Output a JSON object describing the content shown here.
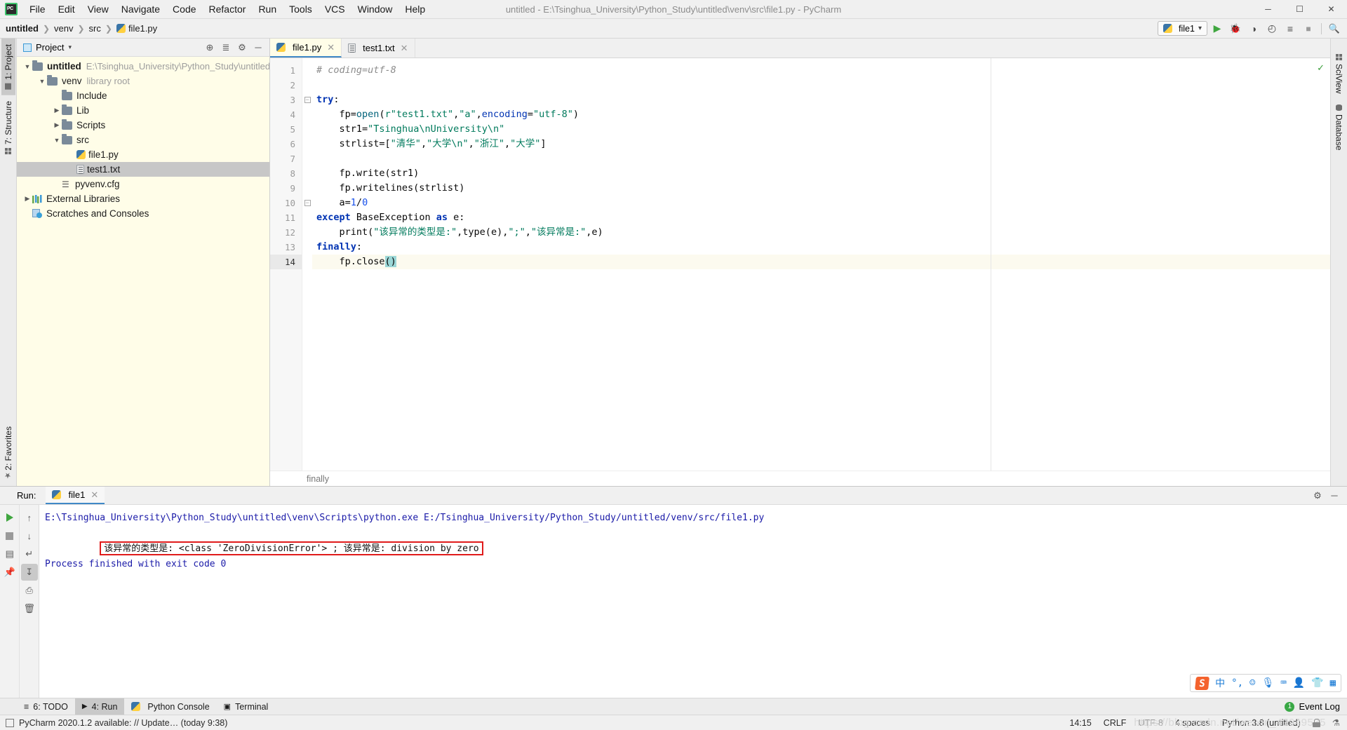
{
  "window": {
    "title": "untitled - E:\\Tsinghua_University\\Python_Study\\untitled\\venv\\src\\file1.py - PyCharm",
    "minimize": "─",
    "maximize": "☐",
    "close": "✕"
  },
  "menu": [
    "File",
    "Edit",
    "View",
    "Navigate",
    "Code",
    "Refactor",
    "Run",
    "Tools",
    "VCS",
    "Window",
    "Help"
  ],
  "breadcrumb": {
    "project": "untitled",
    "venv": "venv",
    "src": "src",
    "file": "file1.py",
    "separator": "❯"
  },
  "toolbar": {
    "run_config": "file1",
    "dropdown_caret": "▾",
    "buttons": [
      {
        "name": "run-button",
        "glyph": "▶",
        "color": "#3fa63f"
      },
      {
        "name": "debug-button",
        "glyph": "🐞",
        "color": "#3fa63f"
      },
      {
        "name": "run-coverage-button",
        "glyph": "◑",
        "color": "#4a4a4a"
      },
      {
        "name": "profile-button",
        "glyph": "◴",
        "color": "#4a4a4a"
      },
      {
        "name": "run-with-params-button",
        "glyph": "≡",
        "color": "#4a4a4a"
      },
      {
        "name": "stop-button",
        "glyph": "■",
        "color": "#9a9a9a"
      },
      {
        "name": "search-everywhere-button",
        "glyph": "🔍",
        "color": "#4a4a4a"
      }
    ]
  },
  "left_strip": [
    {
      "label": "1: Project",
      "active": true,
      "icon": "project-icon"
    },
    {
      "label": "7: Structure",
      "active": false,
      "icon": "structure-icon"
    },
    {
      "label": "2: Favorites",
      "active": false,
      "icon": "star-icon"
    }
  ],
  "right_strip": [
    {
      "label": "SciView",
      "icon": "sciview-icon"
    },
    {
      "label": "Database",
      "icon": "database-icon"
    }
  ],
  "project_panel": {
    "title": "Project",
    "caret": "▾",
    "actions": [
      {
        "name": "locate-icon",
        "glyph": "⊕"
      },
      {
        "name": "collapse-all-icon",
        "glyph": "≣"
      },
      {
        "name": "settings-gear-icon",
        "glyph": "⚙"
      },
      {
        "name": "hide-panel-icon",
        "glyph": "─"
      }
    ],
    "tree": [
      {
        "depth": 0,
        "arrow": "▼",
        "icon": "folder",
        "label": "untitled",
        "bold": true,
        "hint": "E:\\Tsinghua_University\\Python_Study\\untitled",
        "selected": false
      },
      {
        "depth": 1,
        "arrow": "▼",
        "icon": "folder",
        "label": "venv",
        "bold": false,
        "hint": "library root",
        "selected": false
      },
      {
        "depth": 2,
        "arrow": "",
        "icon": "folder",
        "label": "Include",
        "bold": false,
        "hint": "",
        "selected": false
      },
      {
        "depth": 2,
        "arrow": "▶",
        "icon": "folder",
        "label": "Lib",
        "bold": false,
        "hint": "",
        "selected": false
      },
      {
        "depth": 2,
        "arrow": "▶",
        "icon": "folder",
        "label": "Scripts",
        "bold": false,
        "hint": "",
        "selected": false
      },
      {
        "depth": 2,
        "arrow": "▼",
        "icon": "folder",
        "label": "src",
        "bold": false,
        "hint": "",
        "selected": false
      },
      {
        "depth": 3,
        "arrow": "",
        "icon": "python",
        "label": "file1.py",
        "bold": false,
        "hint": "",
        "selected": false
      },
      {
        "depth": 3,
        "arrow": "",
        "icon": "text",
        "label": "test1.txt",
        "bold": false,
        "hint": "",
        "selected": true
      },
      {
        "depth": 2,
        "arrow": "",
        "icon": "cfg",
        "label": "pyvenv.cfg",
        "bold": false,
        "hint": "",
        "selected": false
      },
      {
        "depth": 0,
        "arrow": "▶",
        "icon": "lib",
        "label": "External Libraries",
        "bold": false,
        "hint": "",
        "selected": false
      },
      {
        "depth": 0,
        "arrow": "",
        "icon": "scratch",
        "label": "Scratches and Consoles",
        "bold": false,
        "hint": "",
        "selected": false
      }
    ]
  },
  "editor": {
    "tabs": [
      {
        "label": "file1.py",
        "icon": "python",
        "active": true,
        "close": "✕"
      },
      {
        "label": "test1.txt",
        "icon": "text",
        "active": false,
        "close": "✕"
      }
    ],
    "line_numbers": [
      "1",
      "2",
      "3",
      "4",
      "5",
      "6",
      "7",
      "8",
      "9",
      "10",
      "11",
      "12",
      "13",
      "14"
    ],
    "lines": [
      {
        "n": 1,
        "current": false,
        "fold": "",
        "tokens": [
          {
            "t": "# coding=utf-8",
            "c": "cmt"
          }
        ]
      },
      {
        "n": 2,
        "current": false,
        "fold": "",
        "tokens": []
      },
      {
        "n": 3,
        "current": false,
        "fold": "minus",
        "tokens": [
          {
            "t": "try",
            "c": "kw"
          },
          {
            "t": ":",
            "c": "plain"
          }
        ]
      },
      {
        "n": 4,
        "current": false,
        "fold": "",
        "tokens": [
          {
            "t": "    fp",
            "c": "plain"
          },
          {
            "t": "=",
            "c": "plain"
          },
          {
            "t": "open",
            "c": "fn"
          },
          {
            "t": "(",
            "c": "plain"
          },
          {
            "t": "r\"test1.txt\"",
            "c": "str"
          },
          {
            "t": ",",
            "c": "plain"
          },
          {
            "t": "\"a\"",
            "c": "str"
          },
          {
            "t": ",",
            "c": "plain"
          },
          {
            "t": "encoding",
            "c": "kw2"
          },
          {
            "t": "=",
            "c": "plain"
          },
          {
            "t": "\"utf-8\"",
            "c": "str"
          },
          {
            "t": ")",
            "c": "plain"
          }
        ]
      },
      {
        "n": 5,
        "current": false,
        "fold": "",
        "tokens": [
          {
            "t": "    str1",
            "c": "plain"
          },
          {
            "t": "=",
            "c": "plain"
          },
          {
            "t": "\"Tsinghua\\nUniversity\\n\"",
            "c": "str"
          }
        ]
      },
      {
        "n": 6,
        "current": false,
        "fold": "",
        "tokens": [
          {
            "t": "    strlist",
            "c": "plain"
          },
          {
            "t": "=[",
            "c": "plain"
          },
          {
            "t": "\"清华\"",
            "c": "str"
          },
          {
            "t": ",",
            "c": "plain"
          },
          {
            "t": "\"大学\\n\"",
            "c": "str"
          },
          {
            "t": ",",
            "c": "plain"
          },
          {
            "t": "\"浙江\"",
            "c": "str"
          },
          {
            "t": ",",
            "c": "plain"
          },
          {
            "t": "\"大学\"",
            "c": "str"
          },
          {
            "t": "]",
            "c": "plain"
          }
        ]
      },
      {
        "n": 7,
        "current": false,
        "fold": "",
        "tokens": []
      },
      {
        "n": 8,
        "current": false,
        "fold": "",
        "tokens": [
          {
            "t": "    fp.write(str1)",
            "c": "plain"
          }
        ]
      },
      {
        "n": 9,
        "current": false,
        "fold": "",
        "tokens": [
          {
            "t": "    fp.writelines(strlist)",
            "c": "plain"
          }
        ]
      },
      {
        "n": 10,
        "current": false,
        "fold": "minus",
        "tokens": [
          {
            "t": "    a",
            "c": "plain"
          },
          {
            "t": "=",
            "c": "plain"
          },
          {
            "t": "1",
            "c": "num"
          },
          {
            "t": "/",
            "c": "plain"
          },
          {
            "t": "0",
            "c": "num"
          }
        ]
      },
      {
        "n": 11,
        "current": false,
        "fold": "",
        "tokens": [
          {
            "t": "except",
            "c": "kw"
          },
          {
            "t": " BaseException ",
            "c": "plain"
          },
          {
            "t": "as",
            "c": "kw"
          },
          {
            "t": " e:",
            "c": "plain"
          }
        ]
      },
      {
        "n": 12,
        "current": false,
        "fold": "",
        "tokens": [
          {
            "t": "    print(",
            "c": "plain"
          },
          {
            "t": "\"该异常的类型是:\"",
            "c": "str"
          },
          {
            "t": ",type(e),",
            "c": "plain"
          },
          {
            "t": "\";\"",
            "c": "str"
          },
          {
            "t": ",",
            "c": "plain"
          },
          {
            "t": "\"该异常是:\"",
            "c": "str"
          },
          {
            "t": ",e)",
            "c": "plain"
          }
        ]
      },
      {
        "n": 13,
        "current": false,
        "fold": "",
        "tokens": [
          {
            "t": "finally",
            "c": "kw"
          },
          {
            "t": ":",
            "c": "plain"
          }
        ]
      },
      {
        "n": 14,
        "current": true,
        "fold": "",
        "tokens": [
          {
            "t": "    fp.close",
            "c": "plain"
          },
          {
            "t": "()",
            "c": "plain",
            "hl": true
          }
        ]
      }
    ],
    "status_breadcrumb": "finally",
    "inspection_ok": "✓"
  },
  "run_panel": {
    "label": "Run:",
    "tab": "file1",
    "tab_close": "✕",
    "actions": [
      {
        "name": "settings-gear-icon",
        "glyph": "⚙"
      },
      {
        "name": "hide-panel-icon",
        "glyph": "─"
      }
    ],
    "side_buttons_left": [
      {
        "name": "rerun-button",
        "glyph": "play"
      },
      {
        "name": "stop-button",
        "glyph": "stop"
      },
      {
        "name": "layout-button",
        "glyph": "▤"
      },
      {
        "name": "pin-tab-button",
        "glyph": "📌"
      }
    ],
    "side_buttons_right": [
      {
        "name": "scroll-up-button",
        "glyph": "↑"
      },
      {
        "name": "scroll-down-button",
        "glyph": "↓"
      },
      {
        "name": "soft-wrap-button",
        "glyph": "↵"
      },
      {
        "name": "scroll-to-end-button",
        "glyph": "↧",
        "active": true
      },
      {
        "name": "print-button",
        "glyph": "⎙"
      },
      {
        "name": "clear-all-button",
        "glyph": "🗑"
      }
    ],
    "console": {
      "command": "E:\\Tsinghua_University\\Python_Study\\untitled\\venv\\Scripts\\python.exe E:/Tsinghua_University/Python_Study/untitled/venv/src/file1.py",
      "highlighted_output": "该异常的类型是: <class 'ZeroDivisionError'> ; 该异常是: division by zero",
      "exit_message": "Process finished with exit code 0",
      "highlight_color": "#e01b1b"
    },
    "ime": {
      "logo": "S",
      "items": [
        {
          "name": "chinese-mode-icon",
          "glyph": "中"
        },
        {
          "name": "punctuation-icon",
          "glyph": "°,"
        },
        {
          "name": "emoji-icon",
          "glyph": "☺"
        },
        {
          "name": "voice-input-icon",
          "glyph": "🎙"
        },
        {
          "name": "soft-keyboard-icon",
          "glyph": "⌨"
        },
        {
          "name": "user-icon",
          "glyph": "👤"
        },
        {
          "name": "skin-icon",
          "glyph": "👕"
        },
        {
          "name": "toolbox-icon",
          "glyph": "▦"
        }
      ]
    }
  },
  "tool_windows": [
    {
      "label": "6: TODO",
      "icon": "≡",
      "active": false
    },
    {
      "label": "4: Run",
      "icon": "▶",
      "active": true
    },
    {
      "label": "Python Console",
      "icon": "🐍",
      "active": false
    },
    {
      "label": "Terminal",
      "icon": "▣",
      "active": false
    }
  ],
  "event_log": {
    "count": "1",
    "label": "Event Log"
  },
  "statusbar": {
    "message": "PyCharm 2020.1.2 available: // Update… (today 9:38)",
    "caret": "14:15",
    "line_sep": "CRLF",
    "encoding": "UTF-8",
    "indent": "4 spaces",
    "interpreter": "Python 3.8 (untitled)",
    "lock_icon": "lock-icon",
    "analyze_icon": "⚗",
    "watermark": "https://blog.csdn.net/weixin_43949535"
  }
}
